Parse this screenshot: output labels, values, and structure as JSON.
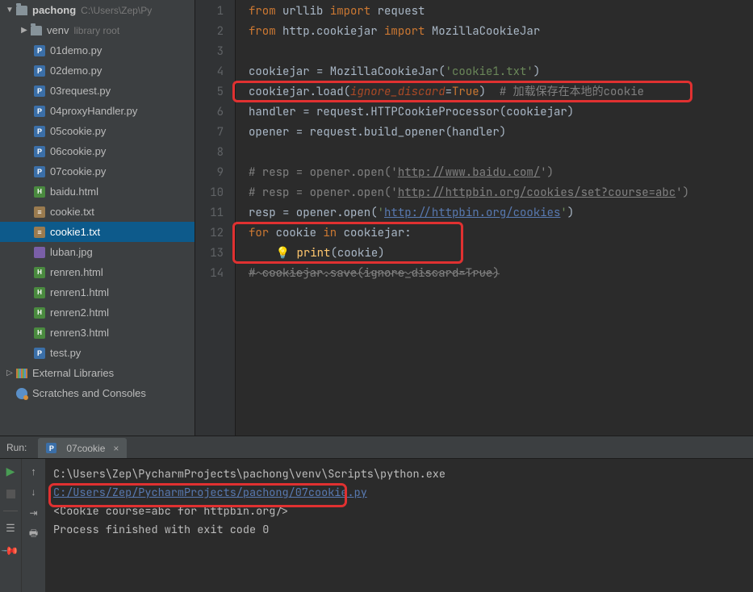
{
  "tree": {
    "root": "pachong",
    "root_path": "C:\\Users\\Zep\\Py",
    "venv": "venv",
    "venv_hint": "library root",
    "ext_lib": "External Libraries",
    "scratches": "Scratches and Consoles",
    "files": [
      {
        "name": "01demo.py",
        "type": "py"
      },
      {
        "name": "02demo.py",
        "type": "py"
      },
      {
        "name": "03request.py",
        "type": "py"
      },
      {
        "name": "04proxyHandler.py",
        "type": "py"
      },
      {
        "name": "05cookie.py",
        "type": "py"
      },
      {
        "name": "06cookie.py",
        "type": "py"
      },
      {
        "name": "07cookie.py",
        "type": "py"
      },
      {
        "name": "baidu.html",
        "type": "html"
      },
      {
        "name": "cookie.txt",
        "type": "txt"
      },
      {
        "name": "cookie1.txt",
        "type": "txt",
        "active": true
      },
      {
        "name": "luban.jpg",
        "type": "img"
      },
      {
        "name": "renren.html",
        "type": "html"
      },
      {
        "name": "renren1.html",
        "type": "html"
      },
      {
        "name": "renren2.html",
        "type": "html"
      },
      {
        "name": "renren3.html",
        "type": "html"
      },
      {
        "name": "test.py",
        "type": "py"
      }
    ]
  },
  "code": {
    "l1": {
      "kw1": "from",
      "mod": " urllib ",
      "kw2": "import",
      "tgt": " request"
    },
    "l2": {
      "kw1": "from",
      "mod": " http.cookiejar ",
      "kw2": "import",
      "tgt": " MozillaCookieJar"
    },
    "l4": {
      "lhs": "cookiejar = MozillaCookieJar(",
      "str": "'cookie1.txt'",
      "rhs": ")"
    },
    "l5": {
      "lhs": "cookiejar.load(",
      "param": "ignore_discard",
      "eq": "=",
      "val": "True",
      "rhs": ")  ",
      "com": "# 加载保存在本地的cookie"
    },
    "l6": {
      "txt": "handler = request.HTTPCookieProcessor(cookiejar)"
    },
    "l7": {
      "txt": "opener = request.build_opener(handler)"
    },
    "l9": {
      "a": "# resp = opener.open('",
      "u": "http://www.baidu.com/",
      "b": "')"
    },
    "l10": {
      "a": "# resp = opener.open('",
      "u": "http://httpbin.org/cookies/set?course=abc",
      "b": "')"
    },
    "l11": {
      "a": "resp = opener.open(",
      "q": "'",
      "u": "http://httpbin.org/cookies",
      "q2": "'",
      "b": ")"
    },
    "l12": {
      "kw1": "for",
      "v": " cookie ",
      "kw2": "in",
      "t": " cookiejar:"
    },
    "l13": {
      "indent": "    ",
      "bulb": "💡",
      "sp": " ",
      "fn": "print",
      "args": "(cookie)"
    },
    "l14": {
      "com": "# cookiejar.save(ignore_discard=True)"
    }
  },
  "run": {
    "label": "Run:",
    "tab": "07cookie",
    "lines": [
      "C:\\Users\\Zep\\PycharmProjects\\pachong\\venv\\Scripts\\python.exe ",
      "C:/Users/Zep/PycharmProjects/pachong/07cookie.py",
      "<Cookie course=abc for httpbin.org/>",
      "",
      "Process finished with exit code 0"
    ]
  }
}
